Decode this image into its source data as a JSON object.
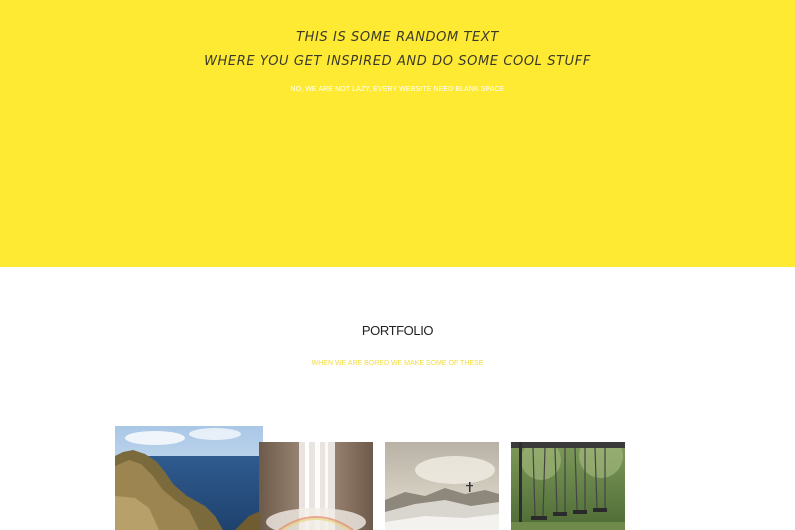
{
  "hero": {
    "line1": "THIS IS SOME RANDOM TEXT",
    "line2": "WHERE YOU GET INSPIRED AND DO SOME COOL STUFF",
    "subtitle": "NO, WE ARE NOT LAZY, EVERY WEBSITE NEED BLANK SPACE"
  },
  "portfolio": {
    "title": "PORTFOLIO",
    "subtitle": "WHEN WE ARE BORED WE MAKE SOME OF THESE",
    "items": [
      {
        "icon": "coastal-cliff-photo"
      },
      {
        "icon": "waterfall-photo"
      },
      {
        "icon": "snowy-mountain-photo"
      },
      {
        "icon": "swings-photo"
      }
    ]
  },
  "colors": {
    "accent": "#ffea33",
    "background": "#ffffff"
  }
}
